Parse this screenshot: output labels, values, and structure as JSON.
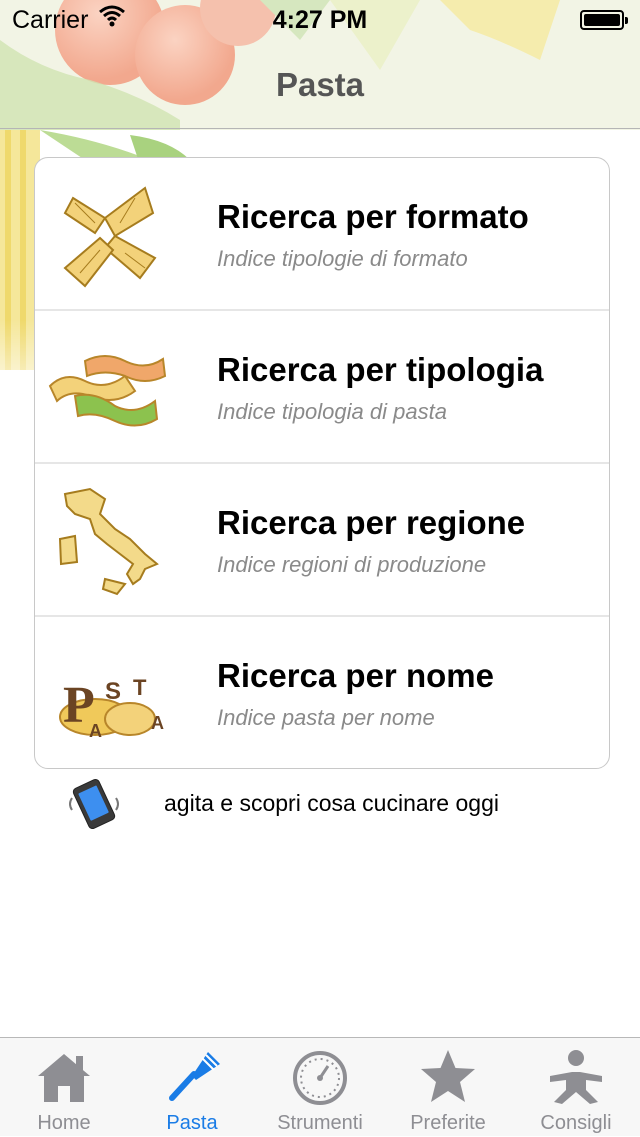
{
  "status_bar": {
    "carrier": "Carrier",
    "time": "4:27 PM"
  },
  "nav": {
    "title": "Pasta"
  },
  "menu": [
    {
      "title": "Ricerca per formato",
      "subtitle": "Indice tipologie di formato",
      "icon": "farfalle-pasta-icon"
    },
    {
      "title": "Ricerca per tipologia",
      "subtitle": "Indice tipologia di pasta",
      "icon": "fusilli-tricolore-icon"
    },
    {
      "title": "Ricerca per regione",
      "subtitle": "Indice regioni di produzione",
      "icon": "italy-map-icon"
    },
    {
      "title": "Ricerca per nome",
      "subtitle": "Indice pasta per nome",
      "icon": "pasta-letters-icon"
    }
  ],
  "shake": {
    "text": "agita e scopri cosa cucinare oggi",
    "icon": "shake-phone-icon"
  },
  "tabs": [
    {
      "label": "Home",
      "icon": "house-icon",
      "active": false
    },
    {
      "label": "Pasta",
      "icon": "pasta-whisk-icon",
      "active": true
    },
    {
      "label": "Strumenti",
      "icon": "dial-icon",
      "active": false
    },
    {
      "label": "Preferite",
      "icon": "star-icon",
      "active": false
    },
    {
      "label": "Consigli",
      "icon": "person-icon",
      "active": false
    }
  ],
  "colors": {
    "accent": "#1a7ce6",
    "tab_inactive": "#8e8e93",
    "subtitle": "#8a8a8a"
  }
}
